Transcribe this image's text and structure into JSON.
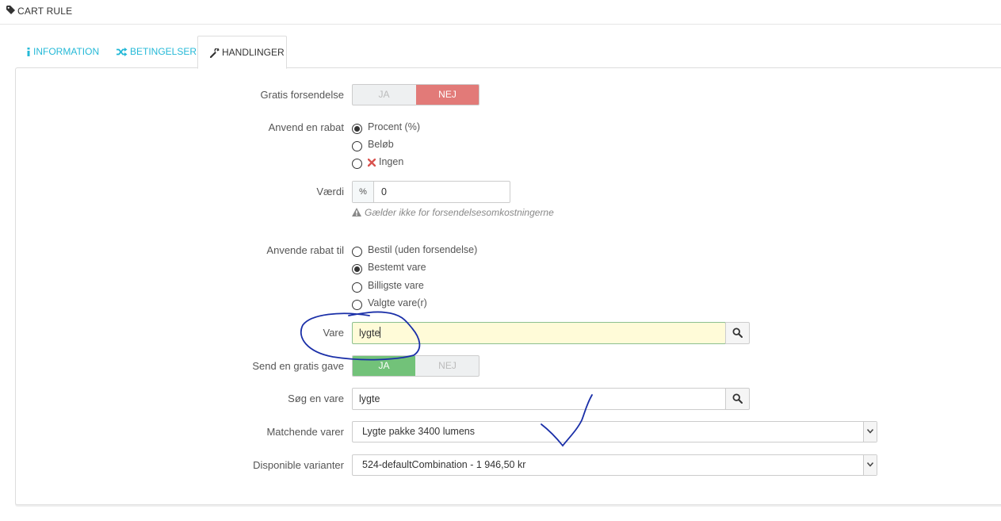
{
  "header": {
    "title": "CART RULE",
    "icon": "tag-icon"
  },
  "tabs": [
    {
      "label": "INFORMATION",
      "icon": "info-icon",
      "active": false
    },
    {
      "label": "BETINGELSER",
      "icon": "shuffle-icon",
      "active": false
    },
    {
      "label": "HANDLINGER",
      "icon": "wrench-icon",
      "active": true
    }
  ],
  "colors": {
    "accent": "#25b9d7",
    "toggle_no": "#e27a78",
    "toggle_yes": "#72c279",
    "highlight_input": "#fffbd8",
    "pen": "#1a2fa8"
  },
  "form": {
    "free_shipping": {
      "label": "Gratis forsendelse",
      "yes": "JA",
      "no": "NEJ",
      "selected": "NEJ"
    },
    "apply_discount": {
      "label": "Anvend en rabat",
      "options": [
        "Procent (%)",
        "Beløb",
        "Ingen"
      ],
      "selected": "Procent (%)"
    },
    "value": {
      "label": "Værdi",
      "unit": "%",
      "value": "0",
      "help": "Gælder ikke for forsendelsesomkostningerne"
    },
    "apply_to": {
      "label": "Anvende rabat til",
      "options": [
        "Bestil (uden forsendelse)",
        "Bestemt vare",
        "Billigste vare",
        "Valgte vare(r)"
      ],
      "selected": "Bestemt vare"
    },
    "product": {
      "label": "Vare",
      "value": "lygte"
    },
    "free_gift": {
      "label": "Send en gratis gave",
      "yes": "JA",
      "no": "NEJ",
      "selected": "JA"
    },
    "search_product": {
      "label": "Søg en vare",
      "value": "lygte"
    },
    "matching": {
      "label": "Matchende varer",
      "selected": "Lygte pakke 3400 lumens"
    },
    "variants": {
      "label": "Disponible varianter",
      "selected": "524-defaultCombination - 1 946,50 kr"
    }
  }
}
